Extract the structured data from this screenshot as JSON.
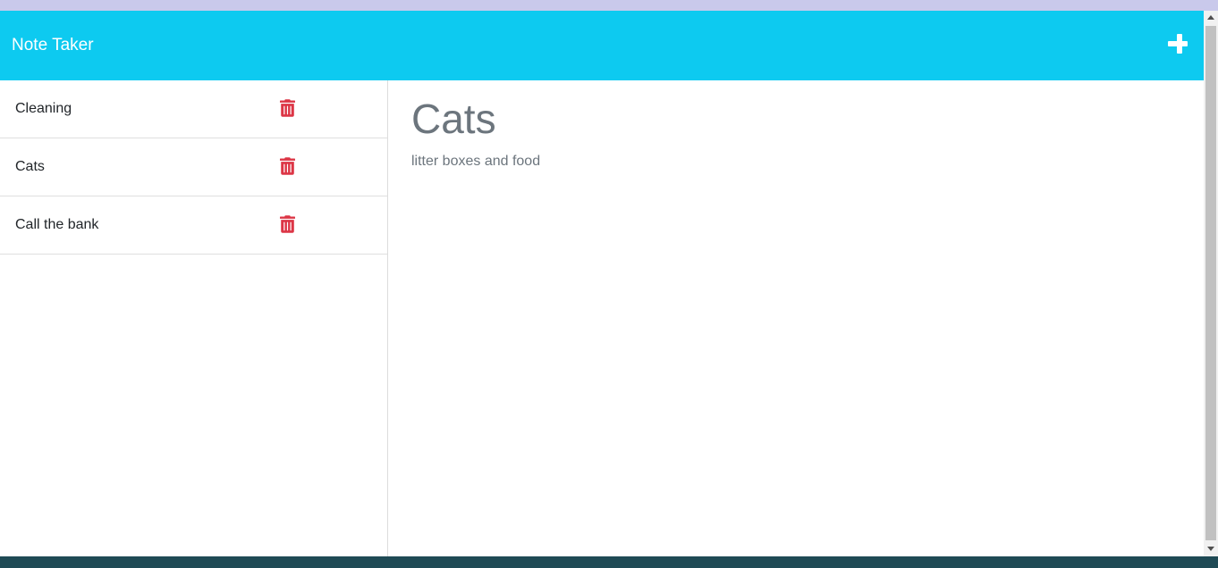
{
  "header": {
    "brand": "Note Taker",
    "add_icon": "plus-icon"
  },
  "sidebar": {
    "notes": [
      {
        "title": "Cleaning",
        "delete_icon": "trash-icon"
      },
      {
        "title": "Cats",
        "delete_icon": "trash-icon"
      },
      {
        "title": "Call the bank",
        "delete_icon": "trash-icon"
      }
    ]
  },
  "main": {
    "note_title": "Cats",
    "note_text": "litter boxes and food"
  },
  "colors": {
    "navbar": "#0dcaf0",
    "delete": "#dc3545",
    "text_muted": "#6c757d"
  }
}
